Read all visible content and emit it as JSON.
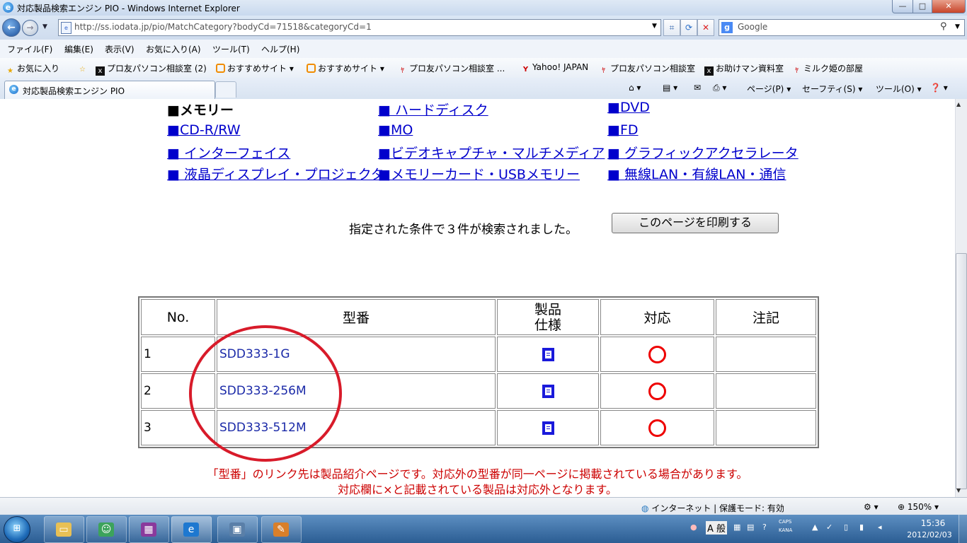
{
  "window": {
    "title": "対応製品検索エンジン PIO - Windows Internet Explorer",
    "min": "—",
    "max": "□",
    "close": "✕"
  },
  "address_bar": {
    "url": "http://ss.iodata.jp/pio/MatchCategory?bodyCd=71518&categoryCd=1",
    "search_placeholder": "Google"
  },
  "menu": [
    "ファイル(F)",
    "編集(E)",
    "表示(V)",
    "お気に入り(A)",
    "ツール(T)",
    "ヘルプ(H)"
  ],
  "favorites": {
    "label": "お気に入り",
    "items": [
      "プロ友パソコン相談室 (2)",
      "おすすめサイト",
      "おすすめサイト",
      "プロ友パソコン相談室 ...",
      "Yahoo! JAPAN",
      "プロ友パソコン相談室",
      "お助けマン資料室",
      "ミルク姫の部屋"
    ]
  },
  "tab": {
    "label": "対応製品検索エンジン PIO"
  },
  "commands": {
    "page": "ページ(P)",
    "safety": "セーフティ(S)",
    "tools": "ツール(O)"
  },
  "categories": {
    "current": "■メモリー",
    "links": [
      "■ ハードディスク",
      "■DVD",
      "■CD-R/RW",
      "■MO",
      "■FD",
      "■ インターフェイス",
      "■ビデオキャプチャ・マルチメディア",
      "■ グラフィックアクセラレータ",
      "■ 液晶ディスプレイ・プロジェクタ",
      "■メモリーカード・USBメモリー",
      "■ 無線LAN・有線LAN・通信"
    ]
  },
  "result": {
    "text": "指定された条件で３件が検索されました。",
    "print_button": "このページを印刷する"
  },
  "table": {
    "headers": {
      "no": "No.",
      "model": "型番",
      "spec_line1": "製品",
      "spec_line2": "仕様",
      "support": "対応",
      "note": "注記"
    },
    "rows": [
      {
        "no": "1",
        "model": "SDD333-1G",
        "support": "○"
      },
      {
        "no": "2",
        "model": "SDD333-256M",
        "support": "○"
      },
      {
        "no": "3",
        "model": "SDD333-512M",
        "support": "○"
      }
    ]
  },
  "notes": {
    "line1": "「型番」のリンク先は製品紹介ページです。対応外の型番が同一ページに掲載されている場合があります。",
    "line2": "対応欄に×と記載されている製品は対応外となります。"
  },
  "status": {
    "zone": "インターネット | 保護モード: 有効",
    "zoom": "150%"
  },
  "taskbar": {
    "ime": "A 般",
    "caps": "CAPS",
    "kana": "KANA",
    "time": "15:36",
    "date": "2012/02/03"
  },
  "colors": {
    "link": "#0000cc",
    "model_link": "#1b2aa8",
    "note_red": "#cc0000",
    "circle_red": "#d81b2a"
  }
}
